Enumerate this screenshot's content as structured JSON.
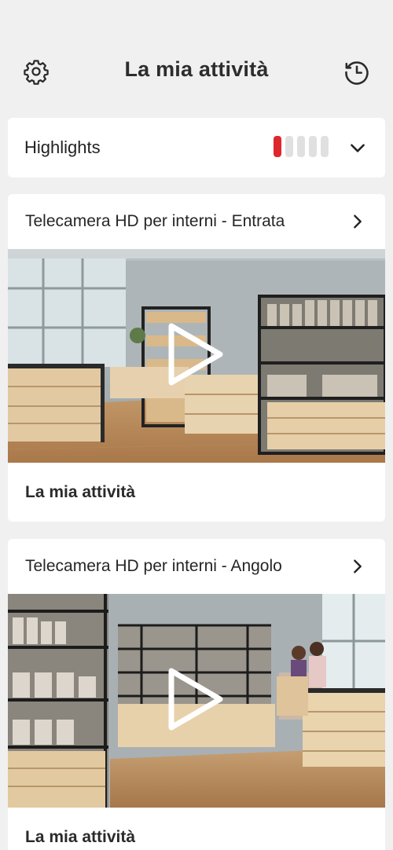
{
  "header": {
    "title": "La mia attività",
    "settings_icon": "gear-icon",
    "history_icon": "history-clock-icon"
  },
  "highlights": {
    "label": "Highlights",
    "bars_total": 5,
    "bars_active": 1,
    "accent_color": "#e0262d",
    "expand_icon": "chevron-down-icon"
  },
  "cameras": [
    {
      "name": "Telecamera HD per interni - Entrata",
      "site": "La mia attività",
      "open_icon": "chevron-right-icon",
      "play_icon": "play-icon"
    },
    {
      "name": "Telecamera HD per interni - Angolo",
      "site": "La mia attività",
      "open_icon": "chevron-right-icon",
      "play_icon": "play-icon"
    }
  ]
}
